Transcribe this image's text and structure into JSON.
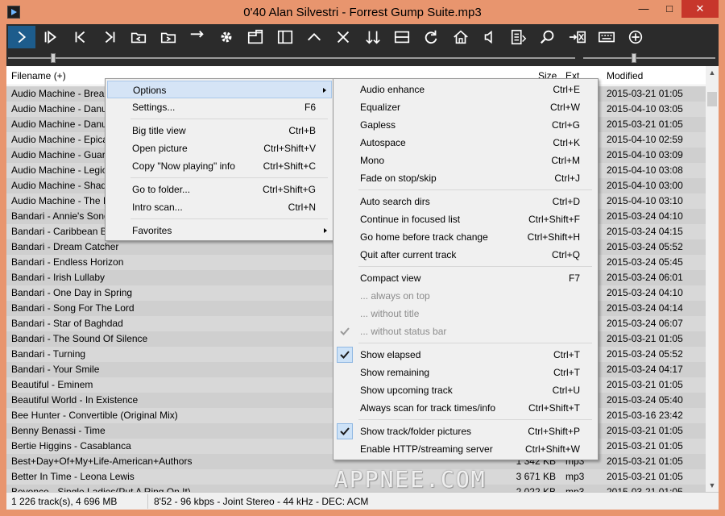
{
  "window": {
    "title": "0'40 Alan Silvestri - Forrest Gump Suite.mp3",
    "min": "—",
    "max": "□",
    "close": "✕"
  },
  "toolbar": [
    "play-icon",
    "play-pause-icon",
    "previous-icon",
    "next-icon",
    "folder-back-icon",
    "folder-forward-icon",
    "arrow-right-icon",
    "settings-gear-icon",
    "window-layout-icon",
    "panel-icon",
    "up-caret-icon",
    "close-x-icon",
    "sort-icon",
    "equal-split-icon",
    "refresh-icon",
    "home-icon",
    "volume-icon",
    "file-info-icon",
    "search-zoom-icon",
    "move-to-icon",
    "keyboard-icon",
    "add-circle-icon"
  ],
  "columns": {
    "filename": "Filename (+)",
    "size": "Size",
    "ext": "Ext",
    "modified": "Modified"
  },
  "rows": [
    {
      "name": "Audio Machine - Brea",
      "date": "2015-03-21 01:05"
    },
    {
      "name": "Audio Machine - Danu",
      "date": "2015-04-10 03:05"
    },
    {
      "name": "Audio Machine - Danu",
      "date": "2015-03-21 01:05"
    },
    {
      "name": "Audio Machine - Epica",
      "date": "2015-04-10 02:59"
    },
    {
      "name": "Audio Machine - Guar",
      "date": "2015-04-10 03:09"
    },
    {
      "name": "Audio Machine - Legio",
      "date": "2015-04-10 03:08"
    },
    {
      "name": "Audio Machine - Shad",
      "date": "2015-04-10 03:00"
    },
    {
      "name": "Audio Machine - The I",
      "date": "2015-04-10 03:10"
    },
    {
      "name": "Bandari - Annie's Song",
      "date": "2015-03-24 04:10"
    },
    {
      "name": "Bandari - Caribbean B",
      "date": "2015-03-24 04:15"
    },
    {
      "name": "Bandari - Dream Catcher",
      "date": "2015-03-24 05:52"
    },
    {
      "name": "Bandari - Endless Horizon",
      "date": "2015-03-24 05:45"
    },
    {
      "name": "Bandari - Irish Lullaby",
      "date": "2015-03-24 06:01"
    },
    {
      "name": "Bandari - One Day in Spring",
      "date": "2015-03-24 04:10"
    },
    {
      "name": "Bandari - Song For The Lord",
      "date": "2015-03-24 04:14"
    },
    {
      "name": "Bandari - Star of Baghdad",
      "date": "2015-03-24 06:07"
    },
    {
      "name": "Bandari - The Sound Of Silence",
      "date": "2015-03-21 01:05"
    },
    {
      "name": "Bandari - Turning",
      "date": "2015-03-24 05:52"
    },
    {
      "name": "Bandari - Your Smile",
      "date": "2015-03-24 04:17"
    },
    {
      "name": "Beautiful - Eminem",
      "date": "2015-03-21 01:05"
    },
    {
      "name": "Beautiful World - In Existence",
      "date": "2015-03-24 05:40"
    },
    {
      "name": "Bee Hunter - Convertible (Original Mix)",
      "date": "2015-03-16 23:42"
    },
    {
      "name": "Benny Benassi - Time",
      "date": "2015-03-21 01:05"
    },
    {
      "name": "Bertie Higgins - Casablanca",
      "date": "2015-03-21 01:05"
    },
    {
      "name": "Best+Day+Of+My+Life-American+Authors",
      "size": "1 342 KB",
      "ext": "mp3",
      "date": "2015-03-21 01:05"
    },
    {
      "name": "Better In Time  -  Leona Lewis",
      "size": "3 671 KB",
      "ext": "mp3",
      "date": "2015-03-21 01:05"
    },
    {
      "name": "Beyonce - Single Ladies(Put A Ring On It)",
      "size": "2 022 KB",
      "ext": "mp3",
      "date": "2015-03-21 01:05"
    }
  ],
  "status": {
    "tracks": "1 226 track(s), 4 696 MB",
    "info": "8'52 - 96 kbps - Joint Stereo - 44 kHz - DEC: ACM"
  },
  "main_menu": [
    {
      "label": "Options",
      "shortcut": "",
      "submenu": true,
      "highlight": true
    },
    {
      "label": "Settings...",
      "shortcut": "F6"
    },
    {
      "sep": true
    },
    {
      "label": "Big title view",
      "shortcut": "Ctrl+B"
    },
    {
      "label": "Open picture",
      "shortcut": "Ctrl+Shift+V"
    },
    {
      "label": "Copy \"Now playing\" info",
      "shortcut": "Ctrl+Shift+C"
    },
    {
      "sep": true
    },
    {
      "label": "Go to folder...",
      "shortcut": "Ctrl+Shift+G"
    },
    {
      "label": "Intro scan...",
      "shortcut": "Ctrl+N"
    },
    {
      "sep": true
    },
    {
      "label": "Favorites",
      "shortcut": "",
      "submenu": true
    }
  ],
  "options_menu": [
    {
      "label": "Audio enhance",
      "shortcut": "Ctrl+E"
    },
    {
      "label": "Equalizer",
      "shortcut": "Ctrl+W"
    },
    {
      "label": "Gapless",
      "shortcut": "Ctrl+G"
    },
    {
      "label": "Autospace",
      "shortcut": "Ctrl+K"
    },
    {
      "label": "Mono",
      "shortcut": "Ctrl+M"
    },
    {
      "label": "Fade on stop/skip",
      "shortcut": "Ctrl+J"
    },
    {
      "sep": true
    },
    {
      "label": "Auto search dirs",
      "shortcut": "Ctrl+D"
    },
    {
      "label": "Continue in focused list",
      "shortcut": "Ctrl+Shift+F"
    },
    {
      "label": "Go home before track change",
      "shortcut": "Ctrl+Shift+H"
    },
    {
      "label": "Quit after current track",
      "shortcut": "Ctrl+Q"
    },
    {
      "sep": true
    },
    {
      "label": "Compact view",
      "shortcut": "F7"
    },
    {
      "label": "... always on top",
      "shortcut": "",
      "disabled": true
    },
    {
      "label": "... without title",
      "shortcut": "",
      "disabled": true
    },
    {
      "label": "... without status bar",
      "shortcut": "",
      "disabled": true,
      "check": "disabled"
    },
    {
      "sep": true
    },
    {
      "label": "Show elapsed",
      "shortcut": "Ctrl+T",
      "check": "on"
    },
    {
      "label": "Show remaining",
      "shortcut": "Ctrl+T"
    },
    {
      "label": "Show upcoming track",
      "shortcut": "Ctrl+U"
    },
    {
      "label": "Always scan for track times/info",
      "shortcut": "Ctrl+Shift+T"
    },
    {
      "sep": true
    },
    {
      "label": "Show track/folder pictures",
      "shortcut": "Ctrl+Shift+P",
      "check": "on"
    },
    {
      "label": "Enable HTTP/streaming server",
      "shortcut": "Ctrl+Shift+W"
    }
  ],
  "watermark": "APPNEE.COM",
  "colors": {
    "frame": "#e8956e",
    "toolbar": "#2b2b2b",
    "toolbar_active": "#1d5c8c",
    "menu_bg": "#f0f0f0",
    "menu_highlight": "#d5e4f6",
    "list_shade": "#cfcfcf"
  }
}
